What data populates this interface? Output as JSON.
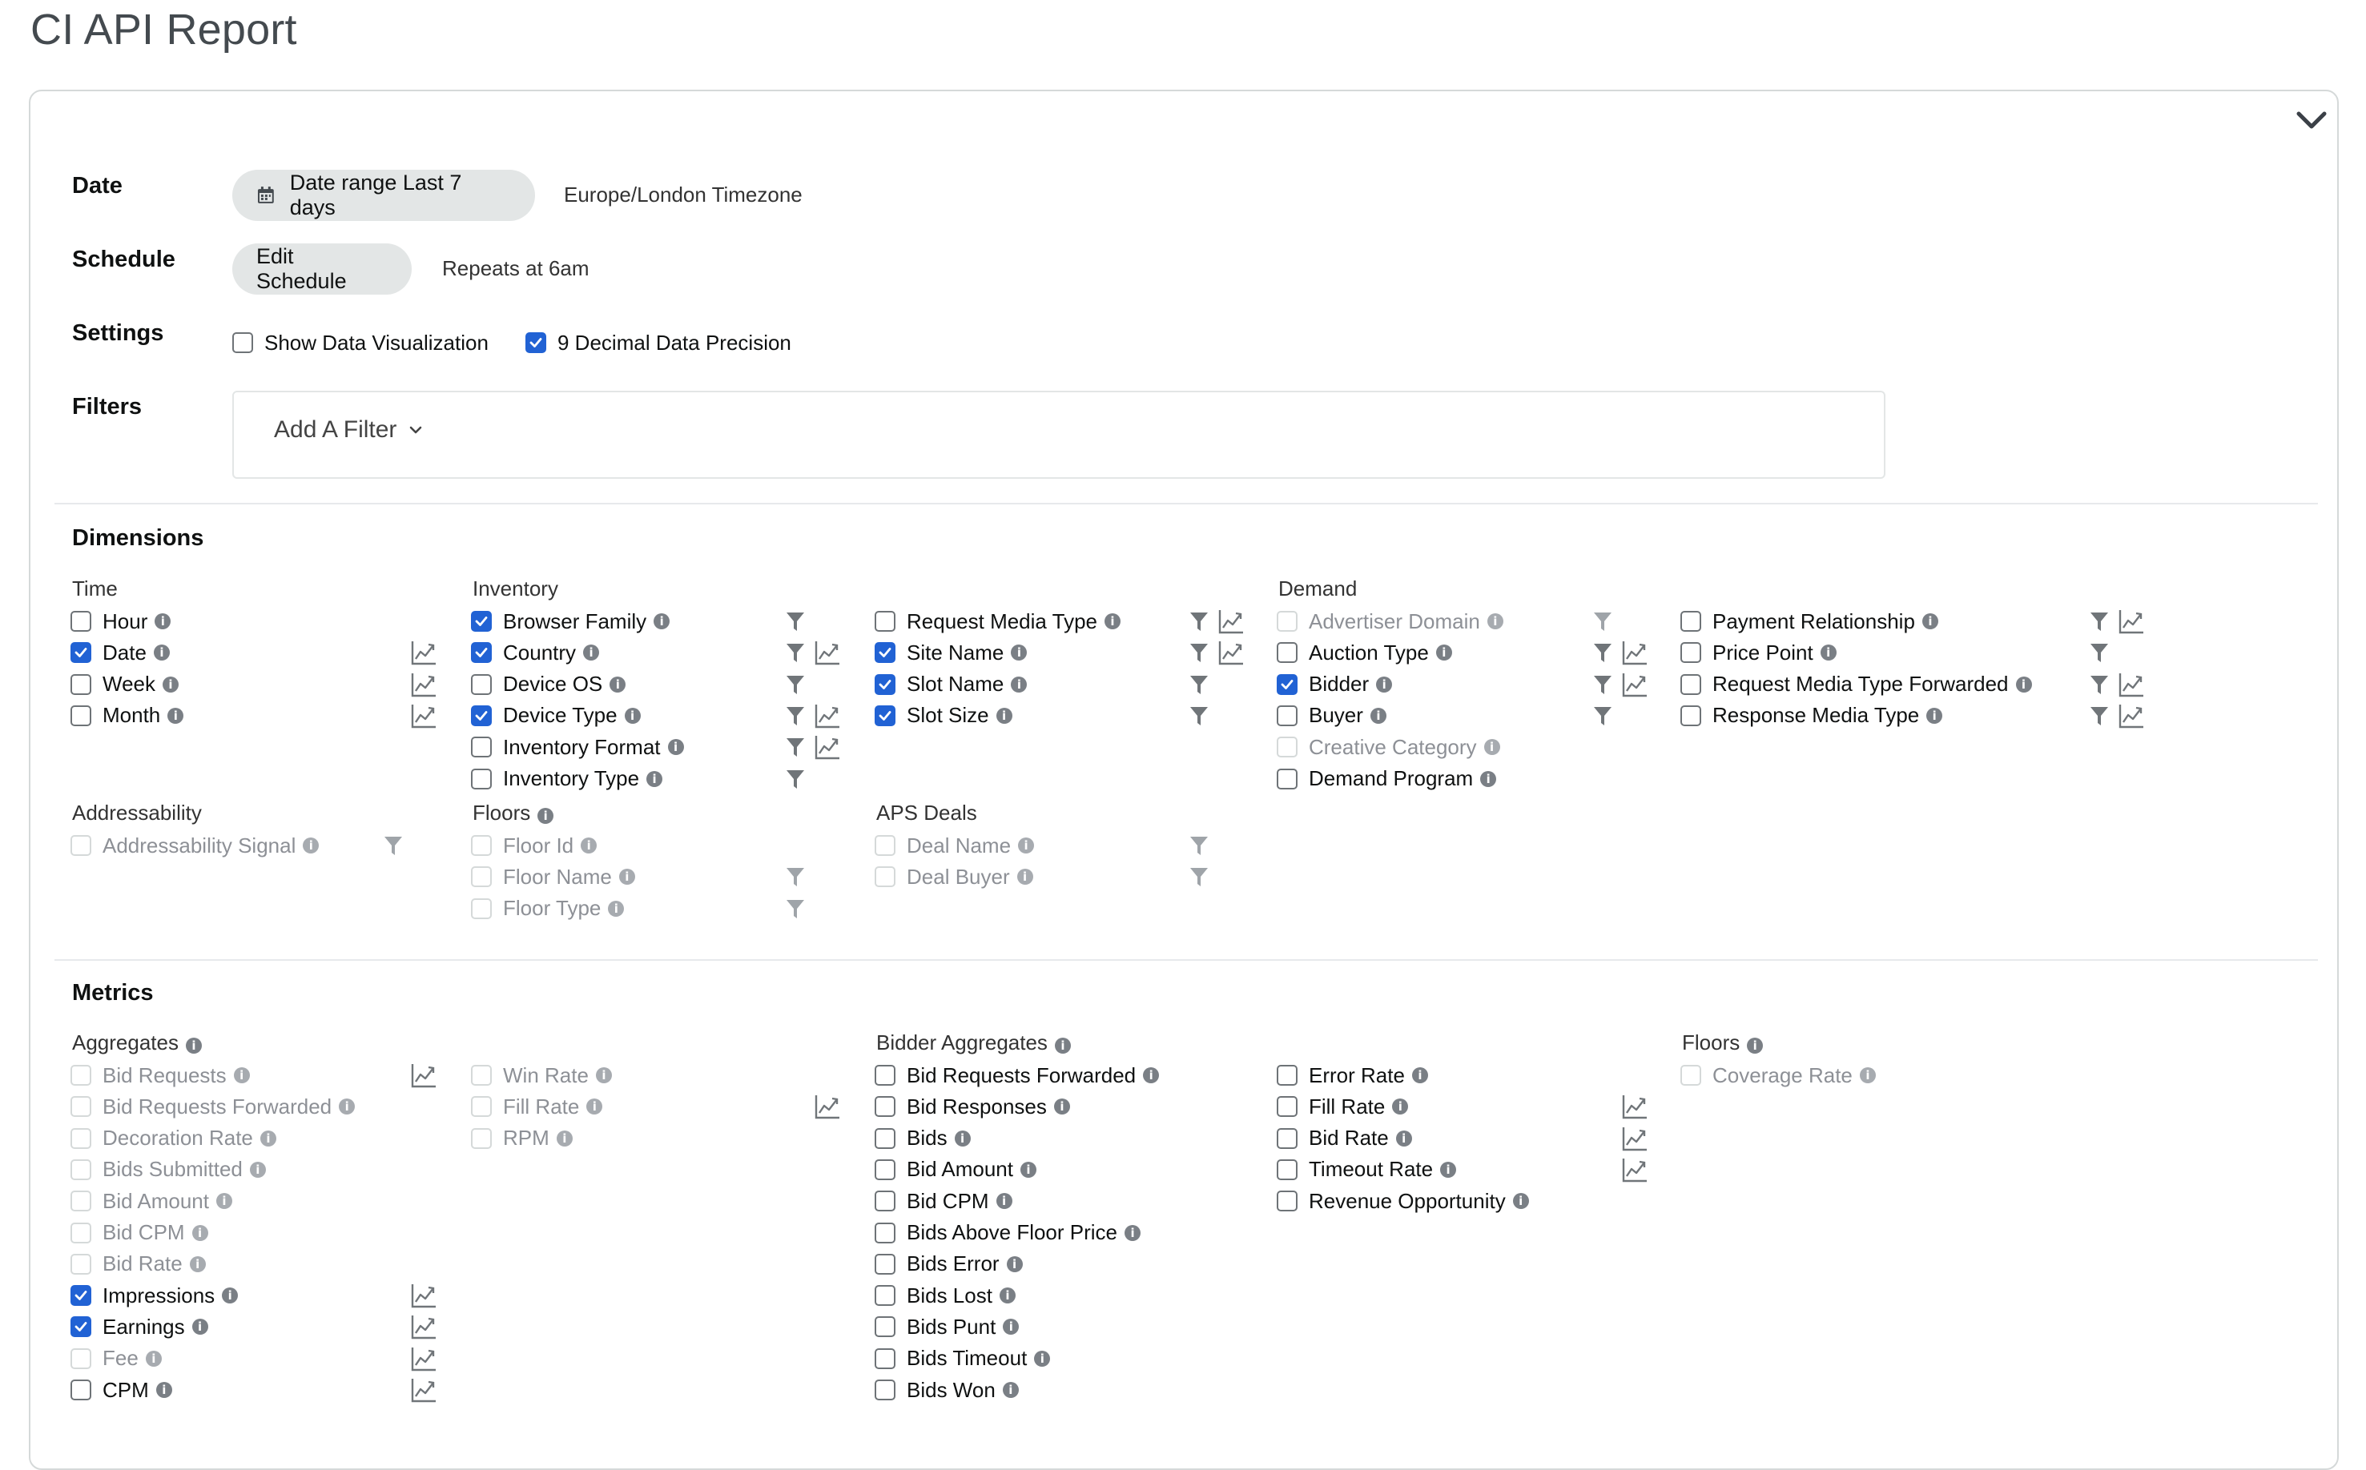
{
  "title": "CI API Report",
  "colors": {
    "accent": "#2162d4",
    "pill_bg": "#e3e6e6",
    "icon_gray": "#7a7f85"
  },
  "icons": {
    "funnel": "filter-icon",
    "chart": "chart-line-icon",
    "info": "info-icon"
  },
  "date": {
    "label": "Date",
    "range_button": "Date range Last 7 days",
    "timezone": "Europe/London Timezone"
  },
  "schedule": {
    "label": "Schedule",
    "edit_button": "Edit Schedule",
    "repeats": "Repeats at 6am"
  },
  "settings": {
    "label": "Settings",
    "show_viz": {
      "label": "Show Data Visualization",
      "checked": false
    },
    "decimal": {
      "label": "9 Decimal Data Precision",
      "checked": true
    }
  },
  "filters": {
    "label": "Filters",
    "add_button": "Add A Filter"
  },
  "dimensions": {
    "title": "Dimensions",
    "time": {
      "title": "Time",
      "items": [
        {
          "label": "Hour",
          "checked": false
        },
        {
          "label": "Date",
          "checked": true
        },
        {
          "label": "Week",
          "checked": false
        },
        {
          "label": "Month",
          "checked": false
        }
      ]
    },
    "inventory": {
      "title": "Inventory",
      "items": [
        {
          "label": "Browser Family",
          "checked": true
        },
        {
          "label": "Country",
          "checked": true
        },
        {
          "label": "Device OS",
          "checked": false
        },
        {
          "label": "Device Type",
          "checked": true
        },
        {
          "label": "Inventory Format",
          "checked": false
        },
        {
          "label": "Inventory Type",
          "checked": false
        }
      ]
    },
    "request": {
      "items": [
        {
          "label": "Request Media Type",
          "checked": false
        },
        {
          "label": "Site Name",
          "checked": true
        },
        {
          "label": "Slot Name",
          "checked": true
        },
        {
          "label": "Slot Size",
          "checked": true
        }
      ]
    },
    "demand": {
      "title": "Demand",
      "items": [
        {
          "label": "Advertiser Domain",
          "checked": false,
          "disabled": true
        },
        {
          "label": "Auction Type",
          "checked": false
        },
        {
          "label": "Bidder",
          "checked": true
        },
        {
          "label": "Buyer",
          "checked": false
        },
        {
          "label": "Creative Category",
          "checked": false,
          "disabled": true
        },
        {
          "label": "Demand Program",
          "checked": false
        }
      ]
    },
    "payment": {
      "items": [
        {
          "label": "Payment Relationship",
          "checked": false
        },
        {
          "label": "Price Point",
          "checked": false
        },
        {
          "label": "Request Media Type Forwarded",
          "checked": false
        },
        {
          "label": "Response Media Type",
          "checked": false
        }
      ]
    },
    "addressability": {
      "title": "Addressability",
      "items": [
        {
          "label": "Addressability Signal",
          "checked": false,
          "disabled": true
        }
      ]
    },
    "floors": {
      "title": "Floors",
      "items": [
        {
          "label": "Floor Id",
          "checked": false,
          "disabled": true
        },
        {
          "label": "Floor Name",
          "checked": false,
          "disabled": true
        },
        {
          "label": "Floor Type",
          "checked": false,
          "disabled": true
        }
      ]
    },
    "aps_deals": {
      "title": "APS Deals",
      "items": [
        {
          "label": "Deal Name",
          "checked": false,
          "disabled": true
        },
        {
          "label": "Deal Buyer",
          "checked": false,
          "disabled": true
        }
      ]
    }
  },
  "metrics": {
    "title": "Metrics",
    "aggregates": {
      "title": "Aggregates",
      "items": [
        {
          "label": "Bid Requests",
          "checked": false,
          "disabled": true
        },
        {
          "label": "Bid Requests Forwarded",
          "checked": false,
          "disabled": true
        },
        {
          "label": "Decoration Rate",
          "checked": false,
          "disabled": true
        },
        {
          "label": "Bids Submitted",
          "checked": false,
          "disabled": true
        },
        {
          "label": "Bid Amount",
          "checked": false,
          "disabled": true
        },
        {
          "label": "Bid CPM",
          "checked": false,
          "disabled": true
        },
        {
          "label": "Bid Rate",
          "checked": false,
          "disabled": true
        },
        {
          "label": "Impressions",
          "checked": true
        },
        {
          "label": "Earnings",
          "checked": true
        },
        {
          "label": "Fee",
          "checked": false,
          "disabled": true
        },
        {
          "label": "CPM",
          "checked": false
        }
      ]
    },
    "rates": {
      "items": [
        {
          "label": "Win Rate",
          "checked": false,
          "disabled": true
        },
        {
          "label": "Fill Rate",
          "checked": false,
          "disabled": true
        },
        {
          "label": "RPM",
          "checked": false,
          "disabled": true
        }
      ]
    },
    "bidder_aggregates": {
      "title": "Bidder Aggregates",
      "items": [
        {
          "label": "Bid Requests Forwarded",
          "checked": false
        },
        {
          "label": "Bid Responses",
          "checked": false
        },
        {
          "label": "Bids",
          "checked": false
        },
        {
          "label": "Bid Amount",
          "checked": false
        },
        {
          "label": "Bid CPM",
          "checked": false
        },
        {
          "label": "Bids Above Floor Price",
          "checked": false
        },
        {
          "label": "Bids Error",
          "checked": false
        },
        {
          "label": "Bids Lost",
          "checked": false
        },
        {
          "label": "Bids Punt",
          "checked": false
        },
        {
          "label": "Bids Timeout",
          "checked": false
        },
        {
          "label": "Bids Won",
          "checked": false
        }
      ]
    },
    "bidder_rates": {
      "items": [
        {
          "label": "Error Rate",
          "checked": false
        },
        {
          "label": "Fill Rate",
          "checked": false
        },
        {
          "label": "Bid Rate",
          "checked": false
        },
        {
          "label": "Timeout Rate",
          "checked": false
        },
        {
          "label": "Revenue Opportunity",
          "checked": false
        }
      ]
    },
    "floors": {
      "title": "Floors",
      "items": [
        {
          "label": "Coverage Rate",
          "checked": false,
          "disabled": true
        }
      ]
    }
  }
}
